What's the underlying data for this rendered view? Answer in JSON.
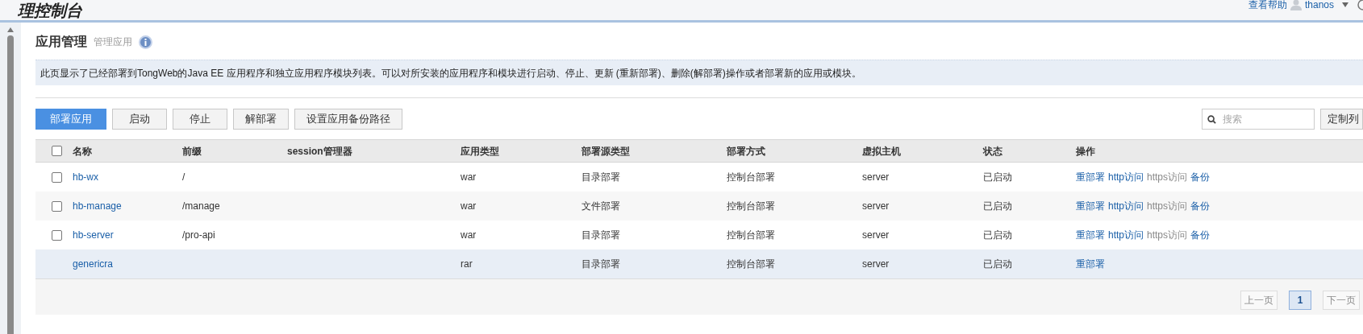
{
  "header": {
    "title": "理控制台",
    "help_link": "查看帮助",
    "user": "thanos"
  },
  "page": {
    "title": "应用管理",
    "subtitle": "管理应用",
    "info": "此页显示了已经部署到TongWeb的Java EE 应用程序和独立应用程序模块列表。可以对所安装的应用程序和模块进行启动、停止、更新 (重新部署)、删除(解部署)操作或者部署新的应用或模块。"
  },
  "toolbar": {
    "buttons": [
      {
        "label": "部署应用",
        "primary": true
      },
      {
        "label": "启动",
        "primary": false
      },
      {
        "label": "停止",
        "primary": false
      },
      {
        "label": "解部署",
        "primary": false
      },
      {
        "label": "设置应用备份路径",
        "primary": false
      }
    ],
    "search": {
      "placeholder": "搜索"
    },
    "customize_button": "定制列"
  },
  "table": {
    "header_checked": false,
    "columns": [
      "名称",
      "前缀",
      "session管理器",
      "应用类型",
      "部署源类型",
      "部署方式",
      "虚拟主机",
      "状态",
      "操作"
    ],
    "rows": [
      {
        "checked": false,
        "selected": false,
        "name": "hb-wx",
        "prefix": "/",
        "session": "",
        "type": "war",
        "source": "目录部署",
        "mode": "控制台部署",
        "host": "server",
        "status": "已启动",
        "actions": [
          {
            "label": "重部署",
            "disabled": false
          },
          {
            "label": "http访问",
            "disabled": false
          },
          {
            "label": "https访问",
            "disabled": true
          },
          {
            "label": "备份",
            "disabled": false
          }
        ]
      },
      {
        "checked": false,
        "selected": false,
        "name": "hb-manage",
        "prefix": "/manage",
        "session": "",
        "type": "war",
        "source": "文件部署",
        "mode": "控制台部署",
        "host": "server",
        "status": "已启动",
        "actions": [
          {
            "label": "重部署",
            "disabled": false
          },
          {
            "label": "http访问",
            "disabled": false
          },
          {
            "label": "https访问",
            "disabled": true
          },
          {
            "label": "备份",
            "disabled": false
          }
        ]
      },
      {
        "checked": false,
        "selected": false,
        "name": "hb-server",
        "prefix": "/pro-api",
        "session": "",
        "type": "war",
        "source": "目录部署",
        "mode": "控制台部署",
        "host": "server",
        "status": "已启动",
        "actions": [
          {
            "label": "重部署",
            "disabled": false
          },
          {
            "label": "http访问",
            "disabled": false
          },
          {
            "label": "https访问",
            "disabled": true
          },
          {
            "label": "备份",
            "disabled": false
          }
        ]
      },
      {
        "selected": true,
        "name": "genericra",
        "prefix": "",
        "session": "",
        "type": "rar",
        "source": "目录部署",
        "mode": "控制台部署",
        "host": "server",
        "status": "已启动",
        "actions": [
          {
            "label": "重部署",
            "disabled": false
          }
        ]
      }
    ]
  },
  "pagination": {
    "prev": {
      "label": "上一页",
      "disabled": true
    },
    "pages": [
      {
        "label": "1",
        "selected": true
      }
    ],
    "next": {
      "label": "下一页",
      "disabled": true
    }
  }
}
